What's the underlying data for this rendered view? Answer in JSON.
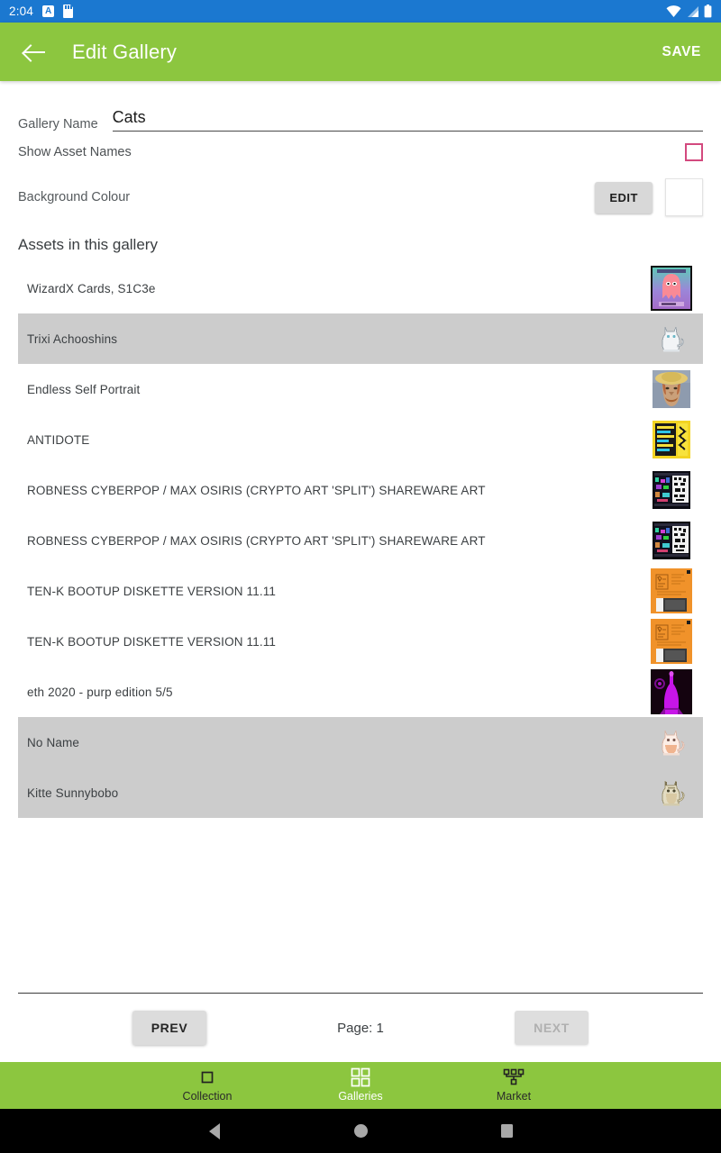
{
  "status_bar": {
    "time": "2:04",
    "left_icons": [
      "auto-rotate-a-icon",
      "sd-card-icon"
    ],
    "right_icons": [
      "wifi-icon",
      "signal-icon",
      "battery-icon"
    ],
    "background": "#1b78d0"
  },
  "app_bar": {
    "back_icon": "back-arrow-icon",
    "title": "Edit Gallery",
    "save_label": "SAVE",
    "background": "#8cc63f"
  },
  "form": {
    "gallery_name_label": "Gallery Name",
    "gallery_name_value": "Cats",
    "gallery_name_placeholder": "Gallery Name",
    "show_asset_names_label": "Show Asset Names",
    "show_asset_names_checked": false,
    "checkbox_colour": "#d3497e",
    "background_colour_label": "Background Colour",
    "edit_label": "EDIT",
    "background_colour_value": "#ffffff"
  },
  "section": {
    "assets_title": "Assets in this gallery"
  },
  "assets": [
    {
      "name": "WizardX Cards, S1C3e",
      "selected": false,
      "thumb": "wizardx-card-thumb"
    },
    {
      "name": "Trixi Achooshins",
      "selected": true,
      "thumb": "white-cat-thumb"
    },
    {
      "name": "Endless Self Portrait",
      "selected": false,
      "thumb": "van-gogh-portrait-thumb"
    },
    {
      "name": "ANTIDOTE",
      "selected": false,
      "thumb": "antidote-yellow-thumb"
    },
    {
      "name": "ROBNESS CYBERPOP / MAX OSIRIS (CRYPTO ART 'SPLIT') SHAREWARE ART",
      "selected": false,
      "thumb": "robness-split-thumb"
    },
    {
      "name": "ROBNESS CYBERPOP / MAX OSIRIS (CRYPTO ART 'SPLIT') SHAREWARE ART",
      "selected": false,
      "thumb": "robness-split-thumb"
    },
    {
      "name": "TEN-K BOOTUP DISKETTE VERSION 11.11",
      "selected": false,
      "thumb": "orange-floppy-thumb"
    },
    {
      "name": "TEN-K BOOTUP DISKETTE VERSION 11.11",
      "selected": false,
      "thumb": "orange-floppy-thumb"
    },
    {
      "name": "eth 2020 - purp edition 5/5",
      "selected": false,
      "thumb": "purple-eth-thumb"
    },
    {
      "name": "No Name",
      "selected": true,
      "thumb": "pink-cat-thumb"
    },
    {
      "name": "Kitte Sunnybobo",
      "selected": true,
      "thumb": "tabby-cat-thumb"
    }
  ],
  "pagination": {
    "prev_label": "PREV",
    "prev_enabled": true,
    "page_label": "Page:",
    "page_number": "1",
    "next_label": "NEXT",
    "next_enabled": false
  },
  "bottom_nav": {
    "items": [
      {
        "label": "Collection",
        "icon": "single-square-icon",
        "active": false
      },
      {
        "label": "Galleries",
        "icon": "grid-four-squares-icon",
        "active": true
      },
      {
        "label": "Market",
        "icon": "market-hierarchy-icon",
        "active": false
      }
    ]
  },
  "system_nav": {
    "back": "triangle-back-icon",
    "home": "circle-home-icon",
    "recents": "square-recents-icon"
  }
}
